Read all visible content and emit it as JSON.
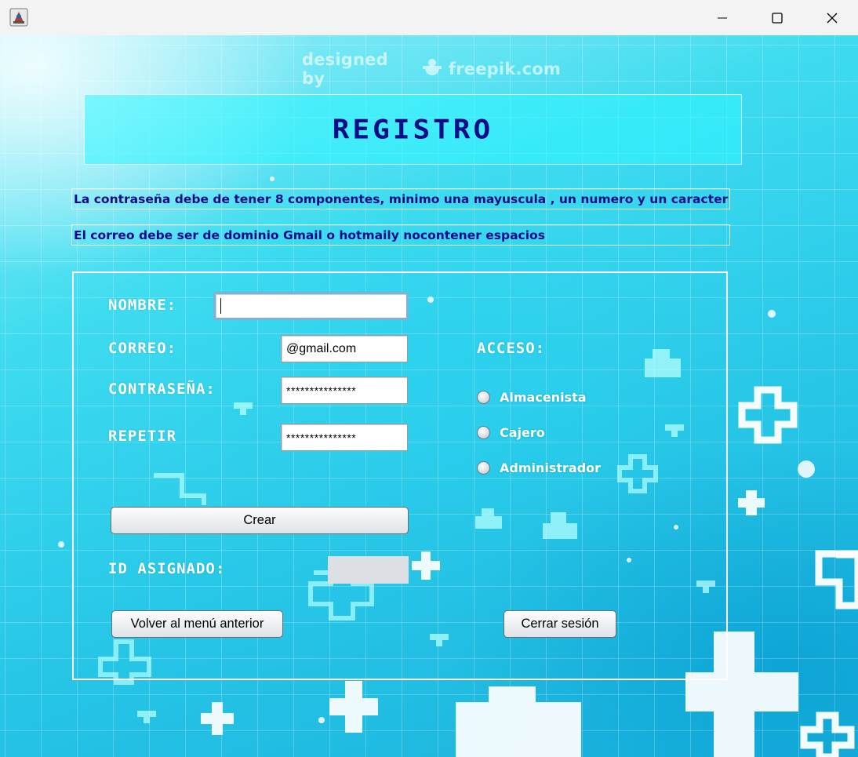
{
  "window": {
    "icon": "java-app-icon",
    "controls": [
      "minimize-icon",
      "maximize-icon",
      "close-icon"
    ]
  },
  "watermark": {
    "text_before": "designed by",
    "text_after": "freepik.com"
  },
  "header": {
    "title": "REGISTRO"
  },
  "info": {
    "password_rule": "La contraseña debe de tener 8 componentes, minimo una mayuscula , un numero y un caracter",
    "email_rule": "El correo debe ser de dominio Gmail o hotmaily nocontener espacios"
  },
  "form": {
    "nombre_label": "NOMBRE:",
    "nombre_value": "",
    "correo_label": "CORREO:",
    "correo_value": "@gmail.com",
    "contrasena_label": "CONTRASEÑA:",
    "contrasena_value": "***************",
    "repetir_label": "REPETIR",
    "repetir_value": "***************",
    "acceso_label": "ACCESO:",
    "roles": [
      {
        "label": "Almacenista",
        "selected": false
      },
      {
        "label": "Cajero",
        "selected": false
      },
      {
        "label": "Administrador",
        "selected": false
      }
    ],
    "crear_label": "Crear",
    "id_label": "ID ASIGNADO:",
    "id_value": "",
    "volver_label": "Volver al menú anterior",
    "cerrar_label": "Cerrar sesión"
  },
  "colors": {
    "title_text": "#0b0b8c",
    "info_text": "#0b0b8c",
    "background_primary": "#28c8e8",
    "label_text": "#ffffff"
  }
}
